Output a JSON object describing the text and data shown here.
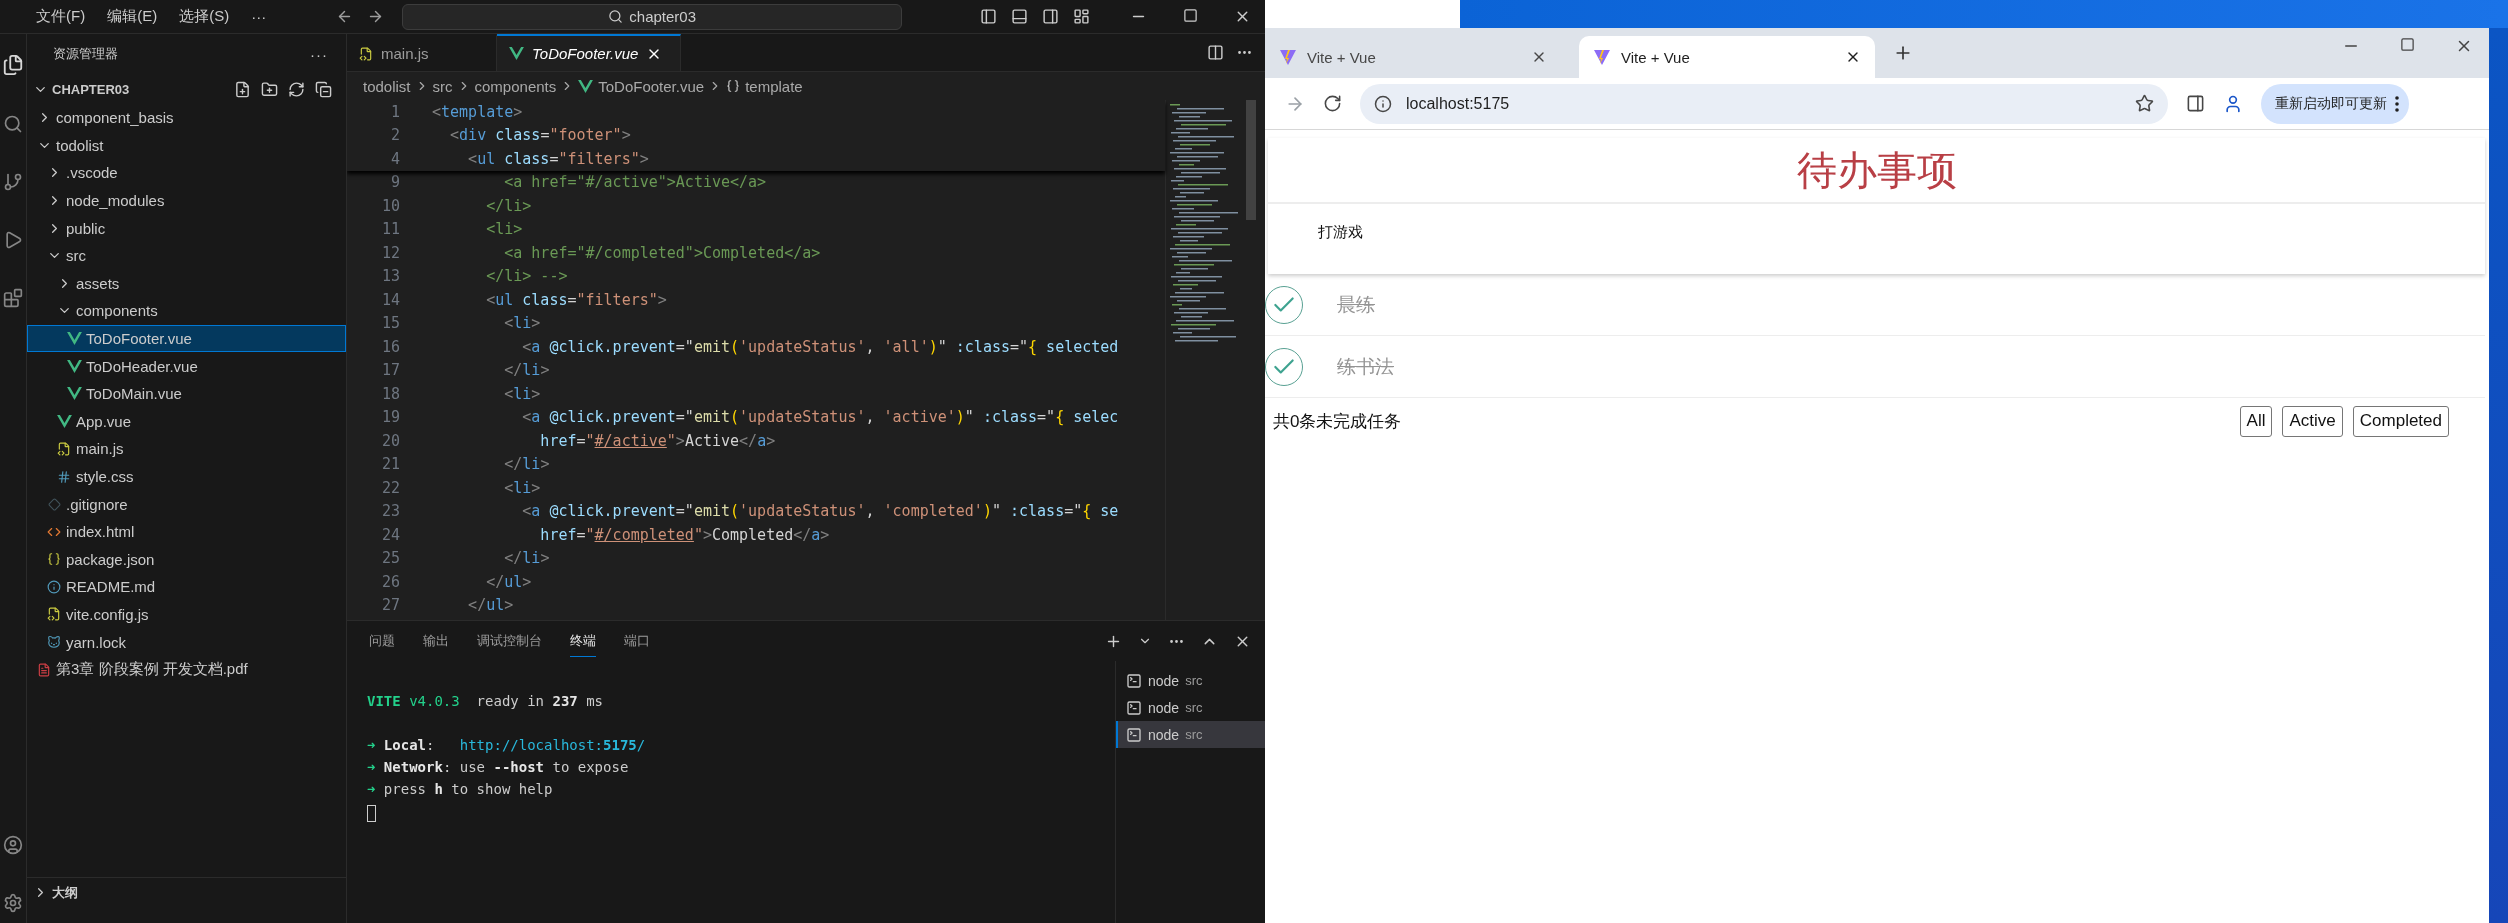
{
  "vscode": {
    "menu": [
      "文件(F)",
      "编辑(E)",
      "选择(S)",
      "···"
    ],
    "command_center": "chapter03",
    "explorer": {
      "title": "资源管理器",
      "more": "···",
      "root": "CHAPTER03",
      "tree": [
        {
          "label": "component_basis",
          "kind": "folder",
          "expanded": false,
          "selected": false
        },
        {
          "label": "todolist",
          "kind": "folder",
          "expanded": true,
          "selected": false,
          "children": [
            {
              "label": ".vscode",
              "kind": "folder",
              "expanded": false,
              "selected": false
            },
            {
              "label": "node_modules",
              "kind": "folder",
              "expanded": false,
              "selected": false
            },
            {
              "label": "public",
              "kind": "folder",
              "expanded": false,
              "selected": false
            },
            {
              "label": "src",
              "kind": "folder",
              "expanded": true,
              "selected": false,
              "children": [
                {
                  "label": "assets",
                  "kind": "folder",
                  "expanded": false,
                  "selected": false
                },
                {
                  "label": "components",
                  "kind": "folder",
                  "expanded": true,
                  "selected": false,
                  "children": [
                    {
                      "label": "ToDoFooter.vue",
                      "kind": "vue",
                      "selected": true
                    },
                    {
                      "label": "ToDoHeader.vue",
                      "kind": "vue",
                      "selected": false
                    },
                    {
                      "label": "ToDoMain.vue",
                      "kind": "vue",
                      "selected": false
                    }
                  ]
                },
                {
                  "label": "App.vue",
                  "kind": "vue",
                  "selected": false
                },
                {
                  "label": "main.js",
                  "kind": "js",
                  "selected": false
                },
                {
                  "label": "style.css",
                  "kind": "css",
                  "selected": false
                }
              ]
            },
            {
              "label": ".gitignore",
              "kind": "git",
              "selected": false
            },
            {
              "label": "index.html",
              "kind": "html",
              "selected": false
            },
            {
              "label": "package.json",
              "kind": "json",
              "selected": false
            },
            {
              "label": "README.md",
              "kind": "info",
              "selected": false
            },
            {
              "label": "vite.config.js",
              "kind": "js",
              "selected": false
            },
            {
              "label": "yarn.lock",
              "kind": "yarn",
              "selected": false
            }
          ]
        },
        {
          "label": "第3章 阶段案例 开发文档.pdf",
          "kind": "pdf",
          "selected": false
        }
      ],
      "outline": "大纲"
    },
    "editor_tabs": [
      {
        "label": "main.js",
        "kind": "js",
        "selected": false,
        "preview": false
      },
      {
        "label": "ToDoFooter.vue",
        "kind": "vue",
        "selected": true,
        "preview": true
      }
    ],
    "breadcrumb": [
      {
        "label": "todolist",
        "kind": "folder"
      },
      {
        "label": "src",
        "kind": "folder"
      },
      {
        "label": "components",
        "kind": "folder"
      },
      {
        "label": "ToDoFooter.vue",
        "kind": "vue"
      },
      {
        "label": "template",
        "kind": "symbol"
      }
    ],
    "sticky_lines": [
      {
        "number": "1",
        "tokens": [
          {
            "kind": "punct",
            "text": "<"
          },
          {
            "kind": "tag",
            "text": "template"
          },
          {
            "kind": "punct",
            "text": ">"
          }
        ]
      },
      {
        "number": "2",
        "tokens": [
          {
            "kind": "punct",
            "text": "  <"
          },
          {
            "kind": "tag",
            "text": "div"
          },
          {
            "kind": "attr",
            "text": " class"
          },
          {
            "kind": "text",
            "text": "="
          },
          {
            "kind": "string",
            "text": "\"footer\""
          },
          {
            "kind": "punct",
            "text": ">"
          }
        ]
      },
      {
        "number": "4",
        "tokens": [
          {
            "kind": "punct",
            "text": "    <"
          },
          {
            "kind": "tag",
            "text": "ul"
          },
          {
            "kind": "attr",
            "text": " class"
          },
          {
            "kind": "text",
            "text": "="
          },
          {
            "kind": "string",
            "text": "\"filters\""
          },
          {
            "kind": "punct",
            "text": ">"
          }
        ]
      }
    ],
    "code_lines": [
      {
        "number": "9",
        "tokens": [
          {
            "kind": "comment",
            "text": "        <a href=\"#/active\">Active</a>"
          }
        ]
      },
      {
        "number": "10",
        "tokens": [
          {
            "kind": "comment",
            "text": "      </li>"
          }
        ]
      },
      {
        "number": "11",
        "tokens": [
          {
            "kind": "comment",
            "text": "      <li>"
          }
        ]
      },
      {
        "number": "12",
        "tokens": [
          {
            "kind": "comment",
            "text": "        <a href=\"#/completed\">Completed</a>"
          }
        ]
      },
      {
        "number": "13",
        "tokens": [
          {
            "kind": "comment",
            "text": "      </li> -->"
          }
        ]
      },
      {
        "number": "14",
        "tokens": [
          {
            "kind": "punct",
            "text": "      <"
          },
          {
            "kind": "tag",
            "text": "ul"
          },
          {
            "kind": "attr",
            "text": " class"
          },
          {
            "kind": "text",
            "text": "="
          },
          {
            "kind": "string",
            "text": "\"filters\""
          },
          {
            "kind": "punct",
            "text": ">"
          }
        ]
      },
      {
        "number": "15",
        "tokens": [
          {
            "kind": "punct",
            "text": "        <"
          },
          {
            "kind": "tag",
            "text": "li"
          },
          {
            "kind": "punct",
            "text": ">"
          }
        ]
      },
      {
        "number": "16",
        "tokens": [
          {
            "kind": "punct",
            "text": "          <"
          },
          {
            "kind": "tag",
            "text": "a"
          },
          {
            "kind": "attr",
            "text": " @click.prevent"
          },
          {
            "kind": "text",
            "text": "=\""
          },
          {
            "kind": "func",
            "text": "emit"
          },
          {
            "kind": "bracket",
            "text": "("
          },
          {
            "kind": "string",
            "text": "'updateStatus'"
          },
          {
            "kind": "text",
            "text": ", "
          },
          {
            "kind": "string",
            "text": "'all'"
          },
          {
            "kind": "bracket",
            "text": ")"
          },
          {
            "kind": "text",
            "text": "\" "
          },
          {
            "kind": "attr",
            "text": ":class"
          },
          {
            "kind": "text",
            "text": "=\""
          },
          {
            "kind": "bracket",
            "text": "{"
          },
          {
            "kind": "var",
            "text": " selected"
          }
        ]
      },
      {
        "number": "17",
        "tokens": [
          {
            "kind": "punct",
            "text": "        </"
          },
          {
            "kind": "tag",
            "text": "li"
          },
          {
            "kind": "punct",
            "text": ">"
          }
        ]
      },
      {
        "number": "18",
        "tokens": [
          {
            "kind": "punct",
            "text": "        <"
          },
          {
            "kind": "tag",
            "text": "li"
          },
          {
            "kind": "punct",
            "text": ">"
          }
        ]
      },
      {
        "number": "19",
        "tokens": [
          {
            "kind": "punct",
            "text": "          <"
          },
          {
            "kind": "tag",
            "text": "a"
          },
          {
            "kind": "attr",
            "text": " @click.prevent"
          },
          {
            "kind": "text",
            "text": "=\""
          },
          {
            "kind": "func",
            "text": "emit"
          },
          {
            "kind": "bracket",
            "text": "("
          },
          {
            "kind": "string",
            "text": "'updateStatus'"
          },
          {
            "kind": "text",
            "text": ", "
          },
          {
            "kind": "string",
            "text": "'active'"
          },
          {
            "kind": "bracket",
            "text": ")"
          },
          {
            "kind": "text",
            "text": "\" "
          },
          {
            "kind": "attr",
            "text": ":class"
          },
          {
            "kind": "text",
            "text": "=\""
          },
          {
            "kind": "bracket",
            "text": "{"
          },
          {
            "kind": "var",
            "text": " selec"
          }
        ]
      },
      {
        "number": "20",
        "tokens": [
          {
            "kind": "attr",
            "text": "            href"
          },
          {
            "kind": "text",
            "text": "="
          },
          {
            "kind": "string",
            "text": "\""
          },
          {
            "kind": "link",
            "text": "#/active"
          },
          {
            "kind": "string",
            "text": "\""
          },
          {
            "kind": "punct",
            "text": ">"
          },
          {
            "kind": "text",
            "text": "Active"
          },
          {
            "kind": "punct",
            "text": "</"
          },
          {
            "kind": "tag",
            "text": "a"
          },
          {
            "kind": "punct",
            "text": ">"
          }
        ]
      },
      {
        "number": "21",
        "tokens": [
          {
            "kind": "punct",
            "text": "        </"
          },
          {
            "kind": "tag",
            "text": "li"
          },
          {
            "kind": "punct",
            "text": ">"
          }
        ]
      },
      {
        "number": "22",
        "tokens": [
          {
            "kind": "punct",
            "text": "        <"
          },
          {
            "kind": "tag",
            "text": "li"
          },
          {
            "kind": "punct",
            "text": ">"
          }
        ]
      },
      {
        "number": "23",
        "tokens": [
          {
            "kind": "punct",
            "text": "          <"
          },
          {
            "kind": "tag",
            "text": "a"
          },
          {
            "kind": "attr",
            "text": " @click.prevent"
          },
          {
            "kind": "text",
            "text": "=\""
          },
          {
            "kind": "func",
            "text": "emit"
          },
          {
            "kind": "bracket",
            "text": "("
          },
          {
            "kind": "string",
            "text": "'updateStatus'"
          },
          {
            "kind": "text",
            "text": ", "
          },
          {
            "kind": "string",
            "text": "'completed'"
          },
          {
            "kind": "bracket",
            "text": ")"
          },
          {
            "kind": "text",
            "text": "\" "
          },
          {
            "kind": "attr",
            "text": ":class"
          },
          {
            "kind": "text",
            "text": "=\""
          },
          {
            "kind": "bracket",
            "text": "{"
          },
          {
            "kind": "var",
            "text": " se"
          }
        ]
      },
      {
        "number": "24",
        "tokens": [
          {
            "kind": "attr",
            "text": "            href"
          },
          {
            "kind": "text",
            "text": "="
          },
          {
            "kind": "string",
            "text": "\""
          },
          {
            "kind": "link",
            "text": "#/completed"
          },
          {
            "kind": "string",
            "text": "\""
          },
          {
            "kind": "punct",
            "text": ">"
          },
          {
            "kind": "text",
            "text": "Completed"
          },
          {
            "kind": "punct",
            "text": "</"
          },
          {
            "kind": "tag",
            "text": "a"
          },
          {
            "kind": "punct",
            "text": ">"
          }
        ]
      },
      {
        "number": "25",
        "tokens": [
          {
            "kind": "punct",
            "text": "        </"
          },
          {
            "kind": "tag",
            "text": "li"
          },
          {
            "kind": "punct",
            "text": ">"
          }
        ]
      },
      {
        "number": "26",
        "tokens": [
          {
            "kind": "punct",
            "text": "      </"
          },
          {
            "kind": "tag",
            "text": "ul"
          },
          {
            "kind": "punct",
            "text": ">"
          }
        ]
      },
      {
        "number": "27",
        "tokens": [
          {
            "kind": "punct",
            "text": "    </"
          },
          {
            "kind": "tag",
            "text": "ul"
          },
          {
            "kind": "punct",
            "text": ">"
          }
        ]
      }
    ],
    "panel_tabs": [
      {
        "label": "问题",
        "selected": false
      },
      {
        "label": "输出",
        "selected": false
      },
      {
        "label": "调试控制台",
        "selected": false
      },
      {
        "label": "终端",
        "selected": true
      },
      {
        "label": "端口",
        "selected": false
      }
    ],
    "terminal_lines": [
      {
        "kind": "status",
        "tokens": [
          {
            "kind": "brand",
            "text": "VITE"
          },
          {
            "kind": "version",
            "text": " v4.0.3"
          },
          {
            "kind": "plain",
            "text": "  ready in "
          },
          {
            "kind": "bold",
            "text": "237"
          },
          {
            "kind": "plain",
            "text": " ms"
          }
        ]
      },
      {
        "kind": "hint",
        "tokens": [
          {
            "kind": "arrow",
            "text": "➜"
          },
          {
            "kind": "bold",
            "text": " Local"
          },
          {
            "kind": "plain",
            "text": ":   "
          },
          {
            "kind": "link",
            "text": "http://localhost:"
          },
          {
            "kind": "linkbold",
            "text": "5175"
          },
          {
            "kind": "link",
            "text": "/"
          }
        ]
      },
      {
        "kind": "hint",
        "tokens": [
          {
            "kind": "arrow",
            "text": "➜"
          },
          {
            "kind": "bold",
            "text": " Network"
          },
          {
            "kind": "plain",
            "text": ": use "
          },
          {
            "kind": "bold",
            "text": "--host"
          },
          {
            "kind": "plain",
            "text": " to expose"
          }
        ]
      },
      {
        "kind": "hint",
        "tokens": [
          {
            "kind": "arrow",
            "text": "➜"
          },
          {
            "kind": "plain",
            "text": " press "
          },
          {
            "kind": "bold",
            "text": "h"
          },
          {
            "kind": "plain",
            "text": " to show help"
          }
        ]
      }
    ],
    "terminals": [
      {
        "name": "node",
        "folder": "src",
        "selected": false
      },
      {
        "name": "node",
        "folder": "src",
        "selected": false
      },
      {
        "name": "node",
        "folder": "src",
        "selected": true
      }
    ]
  },
  "browser": {
    "tabs": [
      {
        "title": "Vite + Vue",
        "selected": false
      },
      {
        "title": "Vite + Vue",
        "selected": true
      }
    ],
    "address": "localhost:5175",
    "update_button": "重新启动即可更新"
  },
  "todo_app": {
    "title": "待办事项",
    "new_todo": {
      "value": "打游戏"
    },
    "items": [
      {
        "text": "晨练",
        "completed": true
      },
      {
        "text": "练书法",
        "completed": true
      }
    ],
    "footer": {
      "summary": "共0条未完成任务",
      "filters": [
        {
          "label": "All",
          "selected": false
        },
        {
          "label": "Active",
          "selected": false
        },
        {
          "label": "Completed",
          "selected": false
        }
      ]
    }
  }
}
